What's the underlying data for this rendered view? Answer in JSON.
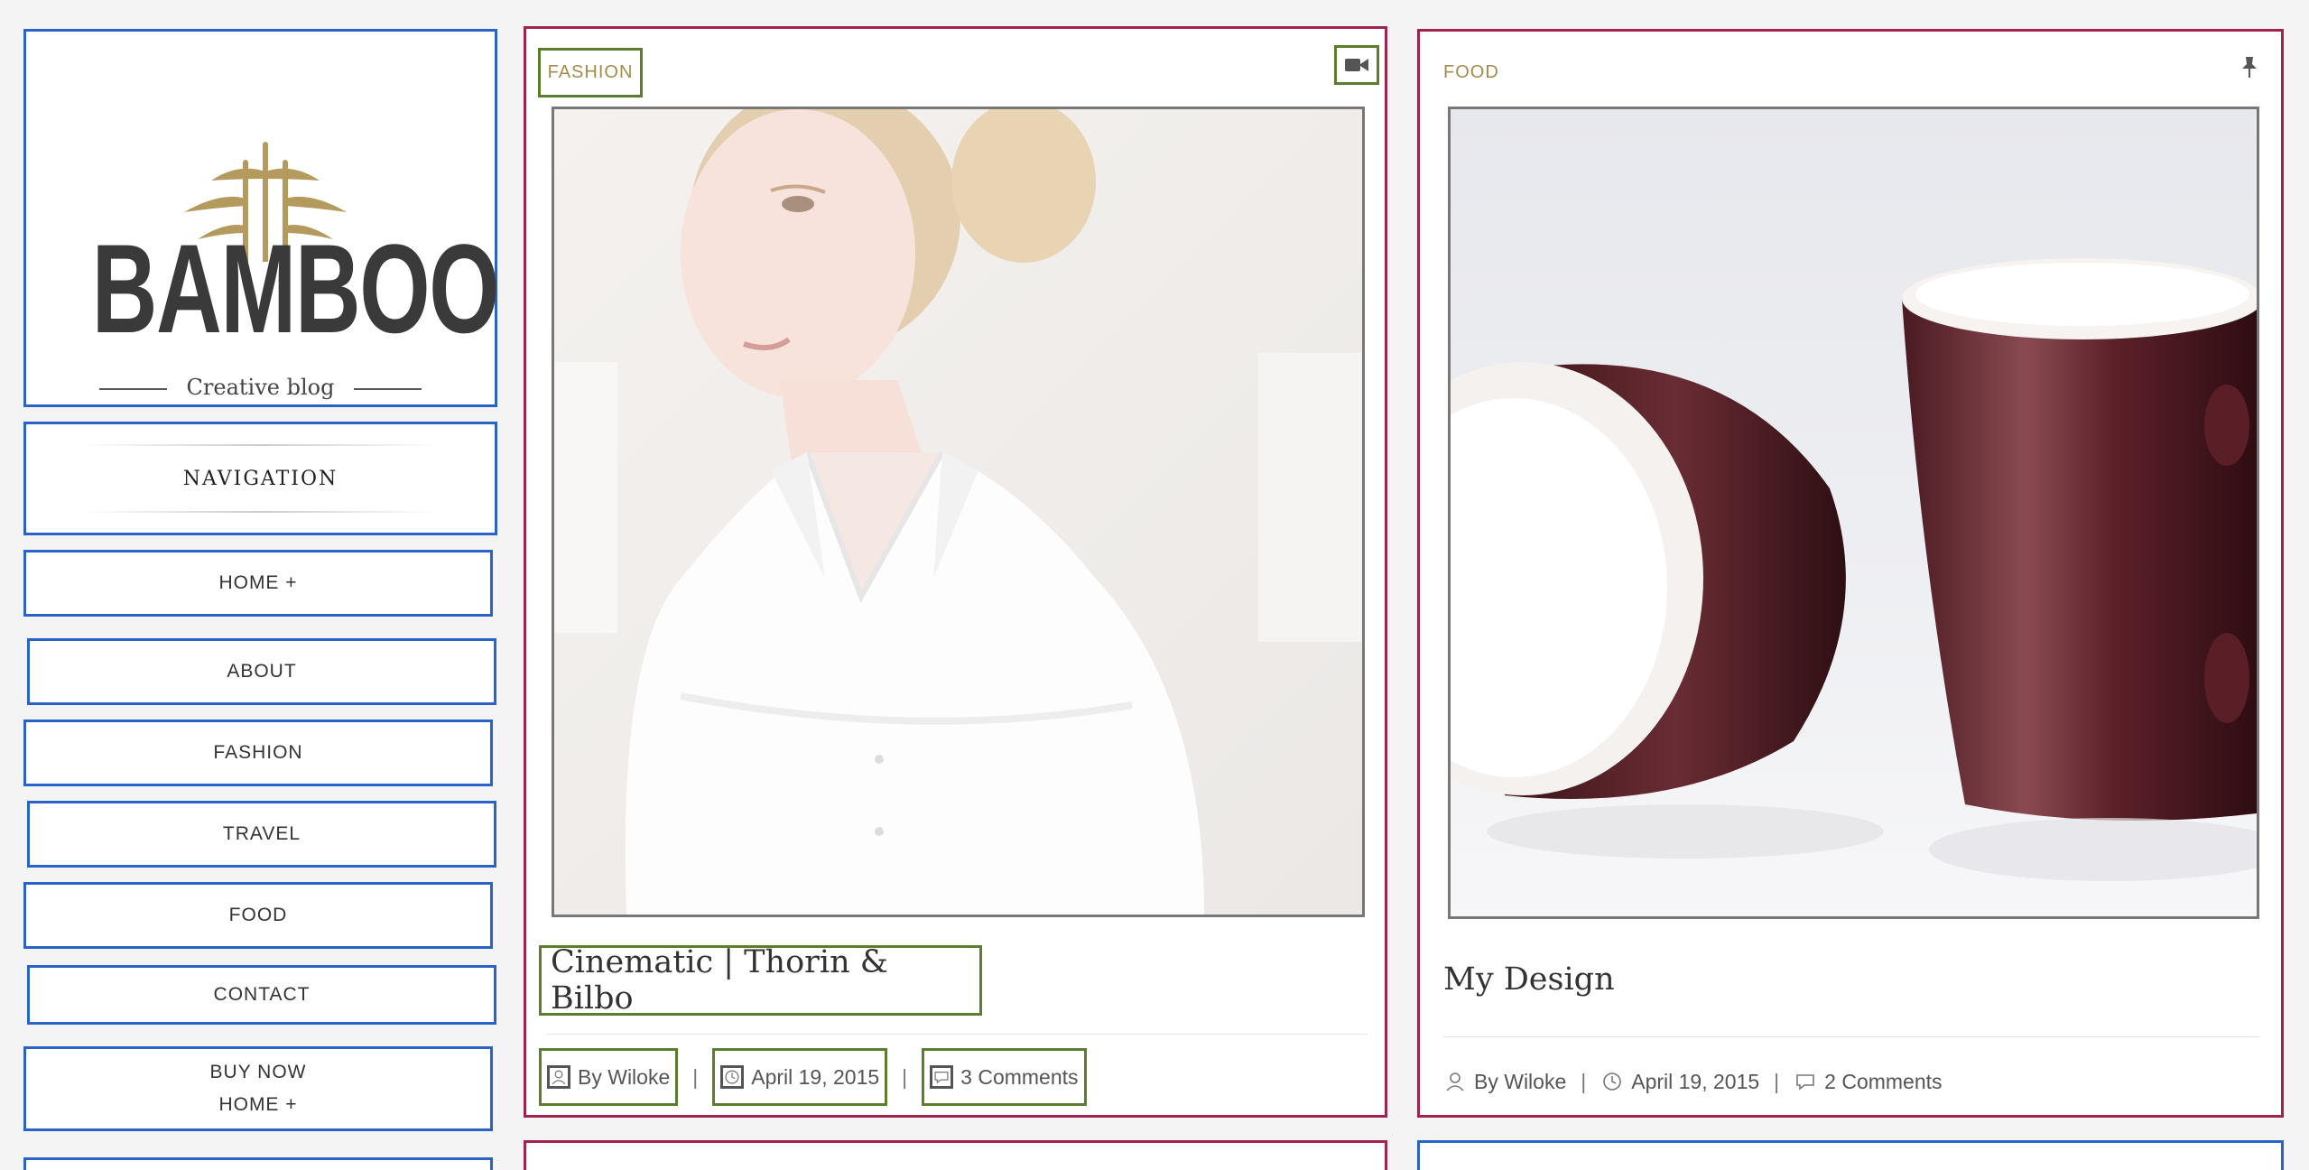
{
  "site": {
    "logo_text": "BAMBOO",
    "tagline": "Creative blog"
  },
  "navigation": {
    "title": "NAVIGATION",
    "items": [
      {
        "label": "HOME +"
      },
      {
        "label": "ABOUT"
      },
      {
        "label": "FASHION"
      },
      {
        "label": "TRAVEL"
      },
      {
        "label": "FOOD"
      },
      {
        "label": "CONTACT"
      },
      {
        "label": "BUY NOW",
        "sub": "HOME +"
      }
    ]
  },
  "posts": [
    {
      "category": "FASHION",
      "format_icon": "video-camera-icon",
      "title": "Cinematic | Thorin & Bilbo",
      "author": "By Wiloke",
      "date": "April 19, 2015",
      "comments": "3 Comments",
      "image": "woman-in-white-shirt"
    },
    {
      "category": "FOOD",
      "format_icon": "pin-icon",
      "title": "My Design",
      "author": "By Wiloke",
      "date": "April 19, 2015",
      "comments": "2 Comments",
      "image": "burgundy-cups"
    }
  ],
  "meta_separator": "|",
  "colors": {
    "category": "#a78b4a",
    "outline_blue": "#2a62c8",
    "outline_red": "#a0224f",
    "outline_green": "#5a7d2e",
    "page_bg": "#f3f4f3"
  }
}
